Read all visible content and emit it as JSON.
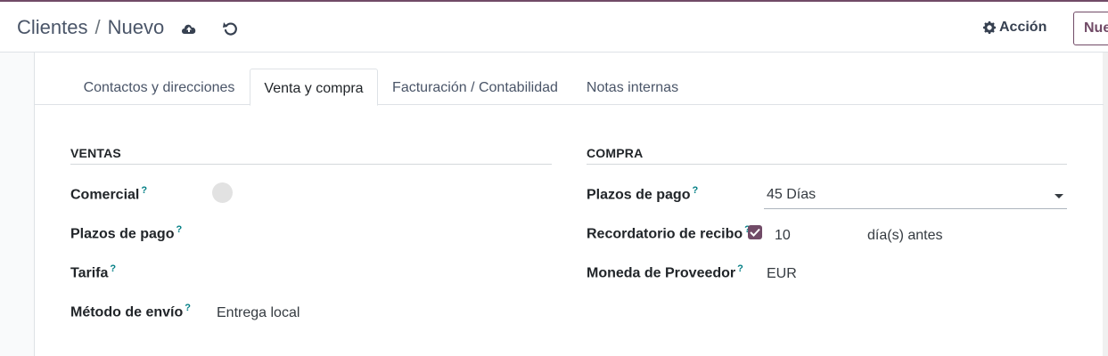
{
  "breadcrumb": {
    "parent": "Clientes",
    "separator": "/",
    "current": "Nuevo"
  },
  "control": {
    "action_label": "Acción",
    "new_label": "Nue"
  },
  "colors": {
    "brand": "#714b67",
    "help": "#017e84"
  },
  "icons": {
    "save": "cloud-upload-icon",
    "discard": "undo-icon",
    "action": "gear-icon",
    "check": "check-icon"
  },
  "tabs": [
    {
      "label": "Contactos y direcciones",
      "active": false
    },
    {
      "label": "Venta y compra",
      "active": true
    },
    {
      "label": "Facturación / Contabilidad",
      "active": false
    },
    {
      "label": "Notas internas",
      "active": false
    }
  ],
  "ventas": {
    "title": "VENTAS",
    "comercial_label": "Comercial",
    "plazos_label": "Plazos de pago",
    "tarifa_label": "Tarifa",
    "metodo_envio_label": "Método de envío",
    "metodo_envio_value": "Entrega local",
    "help_mark": "?"
  },
  "compra": {
    "title": "COMPRA",
    "plazos_label": "Plazos de pago",
    "plazos_value": "45 Días",
    "recordatorio_label": "Recordatorio de recibo",
    "recordatorio_checked": true,
    "recordatorio_days": "10",
    "recordatorio_suffix": "día(s) antes",
    "moneda_label": "Moneda de Proveedor",
    "moneda_value": "EUR",
    "help_mark": "?"
  }
}
